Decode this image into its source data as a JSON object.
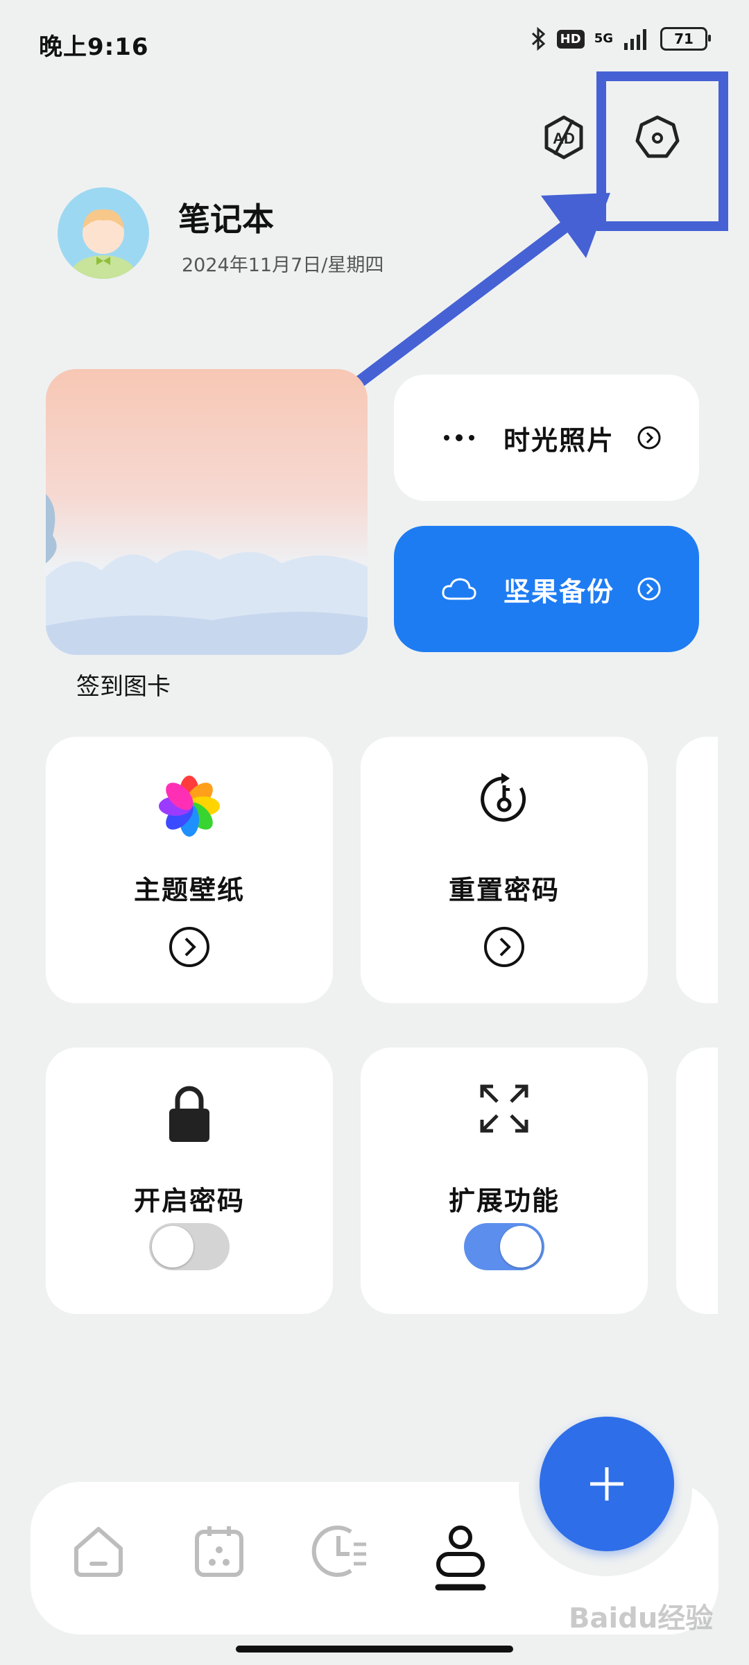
{
  "status_bar": {
    "time": "晚上9:16",
    "hd_badge": "HD",
    "network": "5G",
    "battery": "71"
  },
  "header": {
    "ad_icon": "ad-block-icon",
    "settings_icon": "settings-icon"
  },
  "profile": {
    "title": "笔记本",
    "date": "2024年11月7日/星期四"
  },
  "photo_card": {
    "caption": "签到图卡"
  },
  "quick_actions": [
    {
      "label": "时光照片",
      "icon": "more-dots-icon"
    },
    {
      "label": "坚果备份",
      "icon": "cloud-icon"
    }
  ],
  "features": [
    {
      "label": "主题壁纸",
      "icon": "flower-icon",
      "control": "chevron"
    },
    {
      "label": "重置密码",
      "icon": "reset-key-icon",
      "control": "chevron"
    },
    {
      "label": "开启密码",
      "icon": "lock-icon",
      "control": "toggle",
      "on": false
    },
    {
      "label": "扩展功能",
      "icon": "expand-icon",
      "control": "toggle",
      "on": true
    }
  ],
  "bottom_nav": {
    "items": [
      "home-icon",
      "calendar-icon",
      "history-icon",
      "profile-icon"
    ],
    "active": "profile-icon"
  },
  "fab": {
    "icon": "plus-icon"
  },
  "watermark": "Baidu经验",
  "colors": {
    "accent": "#1e7cf2",
    "fab": "#2e6ee8",
    "annotation": "#4561d4",
    "background": "#eff1f1"
  }
}
